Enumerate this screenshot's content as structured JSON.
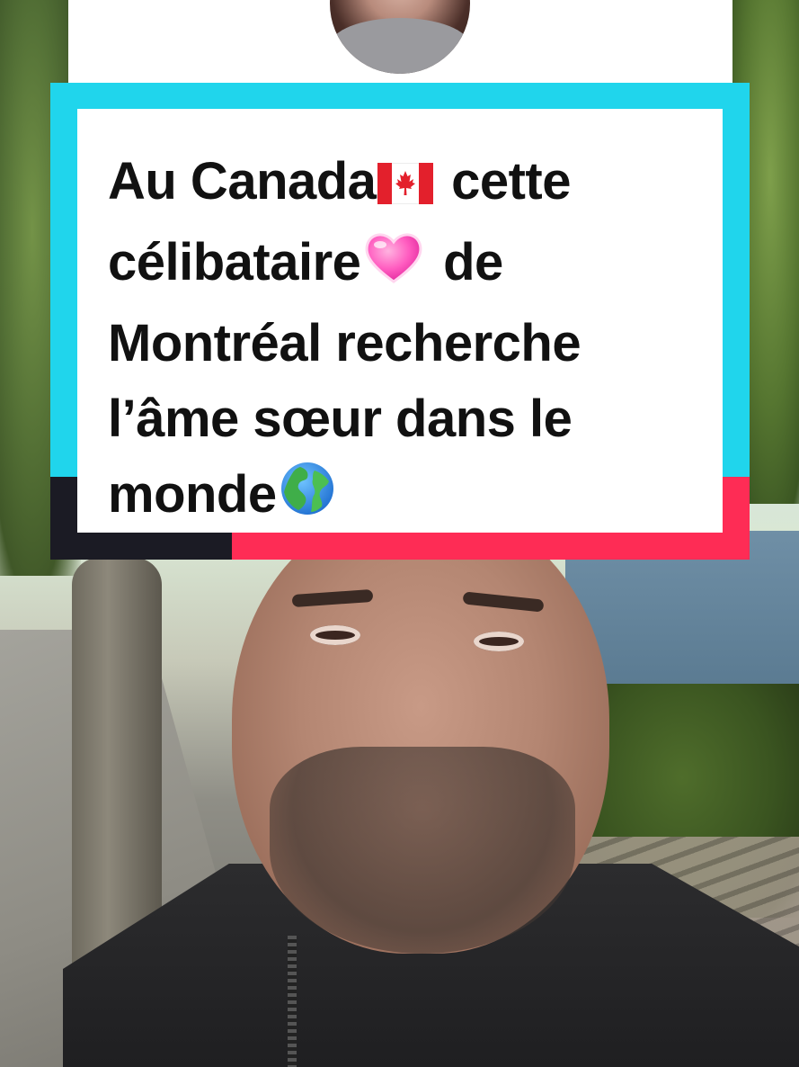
{
  "caption": {
    "lines": [
      {
        "text": "Au Canada",
        "emoji": "canada-flag",
        "after": " cette"
      },
      {
        "text": "célibataire",
        "emoji": "pink-heart",
        "after": " de"
      },
      {
        "text": "Montréal recherche",
        "emoji": "",
        "after": ""
      },
      {
        "text": "l’âme sœur dans le",
        "emoji": "",
        "after": ""
      },
      {
        "text": "monde",
        "emoji": "globe-europe-africa",
        "after": ""
      }
    ]
  },
  "colors": {
    "card_border": "#20d5ec",
    "accent_red": "#fe2c55",
    "accent_dark": "#1b1b24",
    "card_background": "#ffffff",
    "text": "#111111"
  },
  "icons": {
    "canada_flag": "canada-flag-icon",
    "heart": "pink-heart-icon",
    "globe": "globe-icon"
  }
}
